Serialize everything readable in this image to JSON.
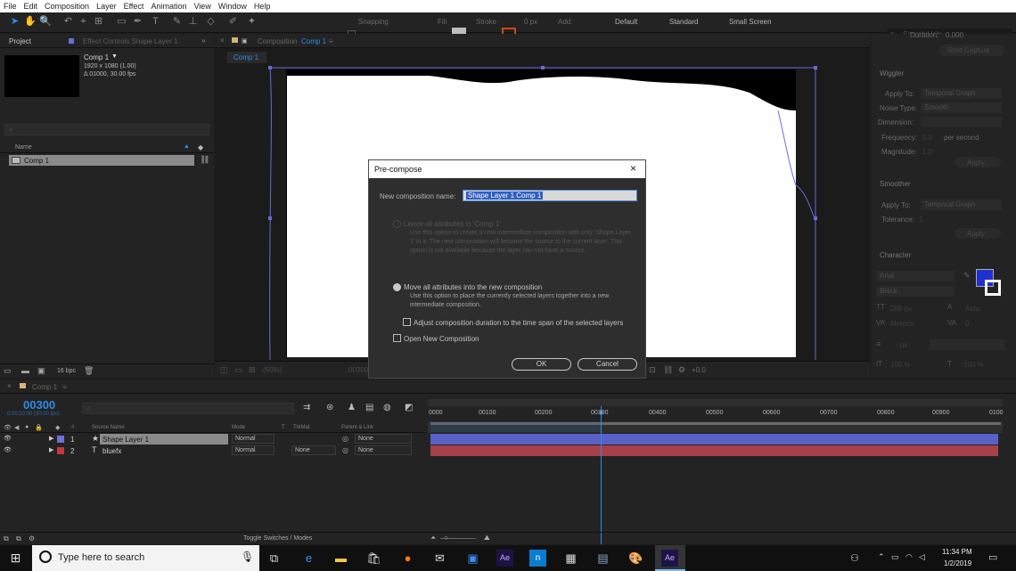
{
  "menu": [
    "File",
    "Edit",
    "Composition",
    "Layer",
    "Effect",
    "Animation",
    "View",
    "Window",
    "Help"
  ],
  "toolbar": {
    "snapping_label": "Snapping",
    "fill_label": "Fill",
    "stroke_label": "Stroke",
    "stroke_px": "0 px",
    "add_label": "Add:",
    "workspaces": [
      "Default",
      "Standard",
      "Small Screen"
    ],
    "search_placeholder": "Search Help"
  },
  "project_panel": {
    "tab_project": "Project",
    "tab_effect_controls": "Effect Controls Shape Layer 1",
    "comp_name": "Comp 1",
    "comp_res": "1920 x 1080 (1.00)",
    "comp_dur": "Δ 01000, 30.00 fps",
    "col_name": "Name",
    "item": "Comp 1",
    "bpc": "16 bpc"
  },
  "comp_panel": {
    "tab_label": "Composition",
    "tab_name": "Comp 1",
    "sub_tab": "Comp 1",
    "zoom": "(50%)",
    "time": "00300",
    "exposure": "+0.0"
  },
  "right_panel": {
    "duration_label": "Duration:",
    "duration_value": "0.000",
    "start_capture": "Start Capture",
    "wiggler_title": "Wiggler",
    "apply_to_label": "Apply To:",
    "apply_to_value": "Temporal Graph",
    "noise_type_label": "Noise Type:",
    "noise_type_value": "Smooth",
    "dimension_label": "Dimension:",
    "frequency_label": "Frequency:",
    "frequency_value": "5.0",
    "frequency_unit": "per second",
    "magnitude_label": "Magnitude:",
    "magnitude_value": "1.0",
    "apply_btn": "Apply",
    "smoother_title": "Smoother",
    "smoother_apply_to_label": "Apply To:",
    "smoother_apply_to_value": "Temporal Graph",
    "tolerance_label": "Tolerance:",
    "tolerance_value": "1",
    "smoother_apply_btn": "Apply",
    "character_title": "Character",
    "font_name": "Arial",
    "font_style": "Black",
    "font_size": "288 px",
    "leading": "Auto",
    "kerning": "Metrics",
    "tracking": "0",
    "stroke_width": "- px",
    "vscale": "100 %",
    "hscale": "100 %",
    "fill_color": "#1f2fd0"
  },
  "dialog": {
    "title": "Pre-compose",
    "name_label": "New composition name:",
    "name_value": "Shape Layer 1 Comp 1",
    "opt1_label": "Leave all attributes in 'Comp 1'",
    "opt1_desc": "Use this option to create a new intermediate composition with only 'Shape Layer 1' in it. The new composition will become the source to the current layer. This option is not available because the layer can not have a source.",
    "opt2_label": "Move all attributes into the new composition",
    "opt2_desc": "Use this option to place the currently selected layers together into a new intermediate composition.",
    "adjust_label": "Adjust composition duration to the time span of the selected layers",
    "open_label": "Open New Composition",
    "ok": "OK",
    "cancel": "Cancel"
  },
  "timeline": {
    "tab_name": "Comp 1",
    "timecode": "00300",
    "timecode_sub": "0:00:10:00 (30.00 fps)",
    "col_source": "Source Name",
    "col_mode": "Mode",
    "col_t": "T",
    "col_trkmat": "TrkMat",
    "col_parent": "Parent & Link",
    "layers": [
      {
        "num": "1",
        "name": "Shape Layer 1",
        "mode": "Normal",
        "trkmat": "",
        "parent": "None",
        "color": "#6f6fd9"
      },
      {
        "num": "2",
        "name": "bluefx",
        "mode": "Normal",
        "trkmat": "None",
        "parent": "None",
        "color": "#c0393b"
      }
    ],
    "ruler": [
      "0000",
      "00100",
      "00200",
      "00300",
      "00400",
      "00500",
      "00600",
      "00700",
      "00800",
      "00900",
      "0100"
    ],
    "toggle_label": "Toggle Switches / Modes"
  },
  "taskbar": {
    "search_placeholder": "Type here to search",
    "time": "11:34 PM",
    "date": "1/2/2019"
  }
}
